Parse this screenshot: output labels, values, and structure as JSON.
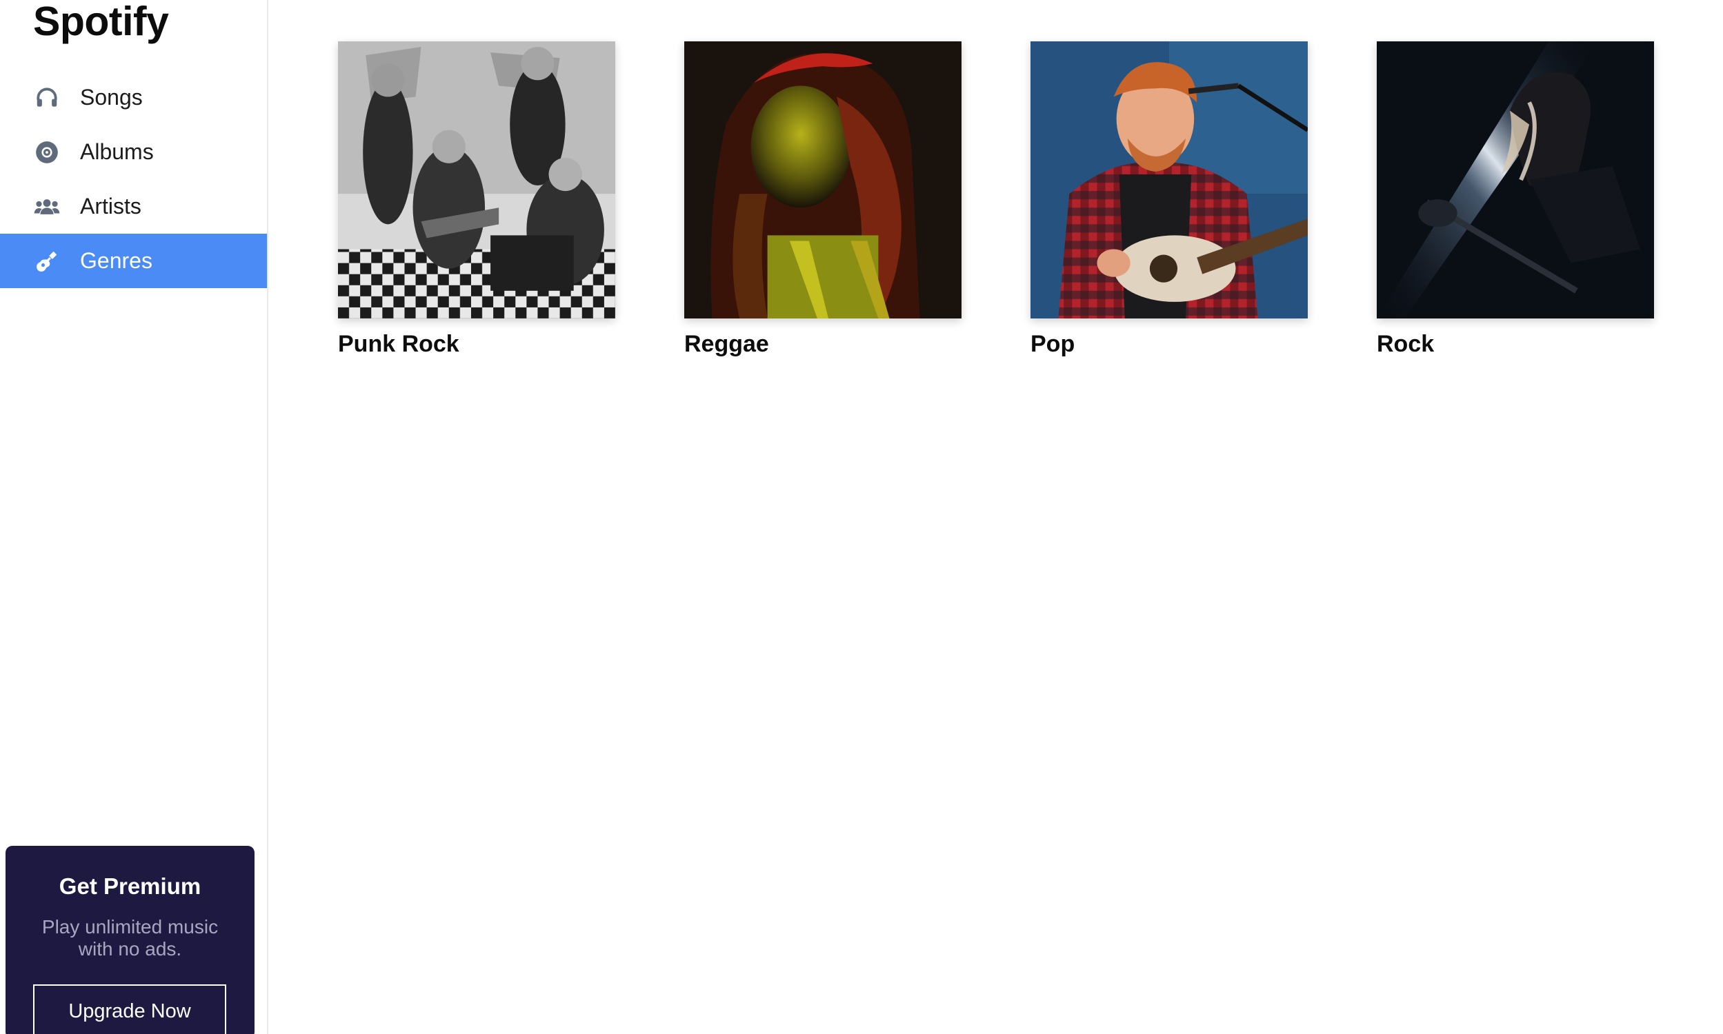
{
  "app": {
    "brand": "Spotify"
  },
  "sidebar": {
    "items": [
      {
        "label": "Songs",
        "icon": "headphones-icon",
        "active": false
      },
      {
        "label": "Albums",
        "icon": "disc-icon",
        "active": false
      },
      {
        "label": "Artists",
        "icon": "users-icon",
        "active": false
      },
      {
        "label": "Genres",
        "icon": "guitar-icon",
        "active": true
      }
    ],
    "accent": "#4a8bf5"
  },
  "premium": {
    "title": "Get Premium",
    "text": "Play unlimited music with no ads.",
    "button": "Upgrade Now",
    "background": "#1d1940"
  },
  "genres": [
    {
      "name": "Punk Rock",
      "image": "punk-rock-photo"
    },
    {
      "name": "Reggae",
      "image": "reggae-photo"
    },
    {
      "name": "Pop",
      "image": "pop-photo"
    },
    {
      "name": "Rock",
      "image": "rock-photo"
    }
  ]
}
